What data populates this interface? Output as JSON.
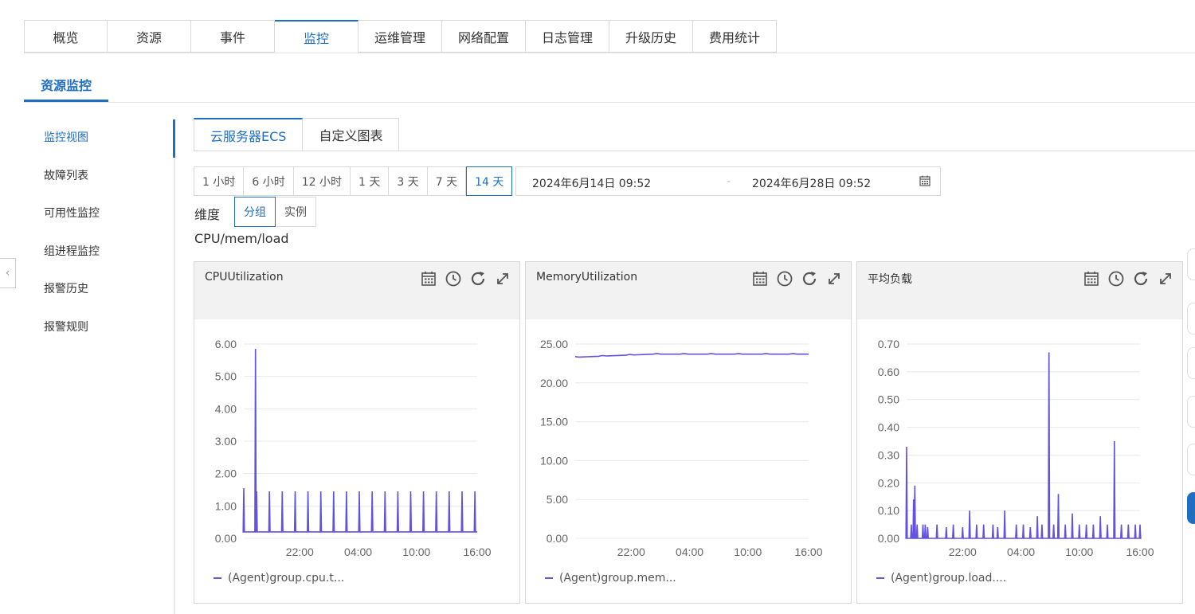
{
  "top_tabs": [
    "概览",
    "资源",
    "事件",
    "监控",
    "运维管理",
    "网络配置",
    "日志管理",
    "升级历史",
    "费用统计"
  ],
  "top_tabs_active": 3,
  "sub_tab": "资源监控",
  "left_nav": [
    "监控视图",
    "故障列表",
    "可用性监控",
    "组进程监控",
    "报警历史",
    "报警规则"
  ],
  "left_nav_active": 0,
  "inner_tabs": [
    "云服务器ECS",
    "自定义图表"
  ],
  "time_ranges": [
    "1 小时",
    "6 小时",
    "12 小时",
    "1 天",
    "3 天",
    "7 天",
    "14 天"
  ],
  "time_range_active": 6,
  "date_range": {
    "start": "2024年6月14日 09:52",
    "separator": "-",
    "end": "2024年6月28日 09:52"
  },
  "dimension": {
    "label": "维度",
    "options": [
      "分组",
      "实例"
    ],
    "active": 0
  },
  "group_title": "CPU/mem/load",
  "colors": {
    "accent": "#1f6ec2",
    "series": "#6351e0"
  },
  "chart_data": [
    {
      "type": "line",
      "title": "CPUUtilization",
      "x_ticks": [
        "22:00",
        "04:00",
        "10:00",
        "16:00"
      ],
      "y_ticks": [
        "6.00",
        "5.00",
        "4.00",
        "3.00",
        "2.00",
        "1.00",
        "0.00"
      ],
      "ylim": [
        0,
        6
      ],
      "series": [
        {
          "name": "(Agent)group.cpu.t...",
          "baseline": 0.2,
          "spikes": [
            [
              0.0,
              1.55
            ],
            [
              0.05,
              5.85
            ],
            [
              0.055,
              1.45
            ],
            [
              0.11,
              1.45
            ],
            [
              0.165,
              1.45
            ],
            [
              0.22,
              1.45
            ],
            [
              0.275,
              1.45
            ],
            [
              0.33,
              1.45
            ],
            [
              0.385,
              1.45
            ],
            [
              0.44,
              1.45
            ],
            [
              0.495,
              1.45
            ],
            [
              0.55,
              1.45
            ],
            [
              0.605,
              1.45
            ],
            [
              0.66,
              1.45
            ],
            [
              0.715,
              1.45
            ],
            [
              0.77,
              1.45
            ],
            [
              0.825,
              1.45
            ],
            [
              0.88,
              1.45
            ],
            [
              0.935,
              1.45
            ],
            [
              0.99,
              1.45
            ]
          ]
        }
      ]
    },
    {
      "type": "line",
      "title": "MemoryUtilization",
      "x_ticks": [
        "22:00",
        "04:00",
        "10:00",
        "16:00"
      ],
      "y_ticks": [
        "25.00",
        "20.00",
        "15.00",
        "10.00",
        "5.00",
        "0.00"
      ],
      "ylim": [
        0,
        25
      ],
      "series": [
        {
          "name": "(Agent)group.mem...",
          "start": 23.3,
          "end": 23.7
        }
      ]
    },
    {
      "type": "line",
      "title": "平均负载",
      "x_ticks": [
        "22:00",
        "04:00",
        "10:00",
        "16:00"
      ],
      "y_ticks": [
        "0.70",
        "0.60",
        "0.50",
        "0.40",
        "0.30",
        "0.20",
        "0.10",
        "0.00"
      ],
      "ylim": [
        0,
        0.7
      ],
      "series": [
        {
          "name": "(Agent)group.load....",
          "baseline": 0.0,
          "spikes": [
            [
              0.0,
              0.33
            ],
            [
              0.02,
              0.05
            ],
            [
              0.03,
              0.14
            ],
            [
              0.035,
              0.19
            ],
            [
              0.045,
              0.05
            ],
            [
              0.07,
              0.05
            ],
            [
              0.08,
              0.05
            ],
            [
              0.09,
              0.04
            ],
            [
              0.13,
              0.05
            ],
            [
              0.17,
              0.04
            ],
            [
              0.2,
              0.05
            ],
            [
              0.24,
              0.04
            ],
            [
              0.27,
              0.1
            ],
            [
              0.3,
              0.05
            ],
            [
              0.33,
              0.05
            ],
            [
              0.37,
              0.05
            ],
            [
              0.39,
              0.04
            ],
            [
              0.42,
              0.1
            ],
            [
              0.47,
              0.05
            ],
            [
              0.5,
              0.05
            ],
            [
              0.53,
              0.04
            ],
            [
              0.56,
              0.08
            ],
            [
              0.58,
              0.05
            ],
            [
              0.61,
              0.67
            ],
            [
              0.63,
              0.05
            ],
            [
              0.65,
              0.16
            ],
            [
              0.68,
              0.05
            ],
            [
              0.71,
              0.09
            ],
            [
              0.74,
              0.05
            ],
            [
              0.77,
              0.05
            ],
            [
              0.8,
              0.05
            ],
            [
              0.83,
              0.08
            ],
            [
              0.86,
              0.05
            ],
            [
              0.89,
              0.35
            ],
            [
              0.92,
              0.05
            ],
            [
              0.95,
              0.05
            ],
            [
              0.98,
              0.05
            ],
            [
              1.0,
              0.05
            ]
          ]
        }
      ]
    }
  ]
}
